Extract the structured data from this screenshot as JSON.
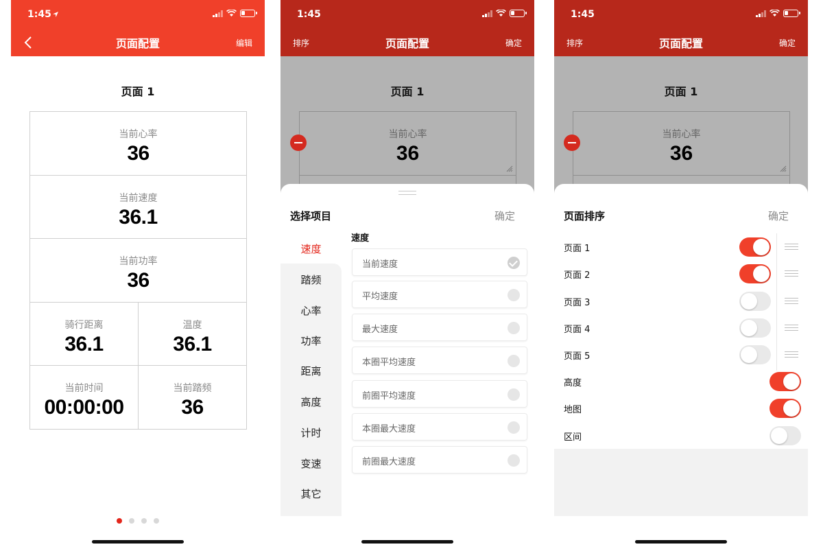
{
  "status": {
    "time": "1:45"
  },
  "screen1": {
    "title": "页面配置",
    "right_action": "编辑",
    "page_label": "页面 1",
    "cells": [
      {
        "label": "当前心率",
        "value": "36"
      },
      {
        "label": "当前速度",
        "value": "36.1"
      },
      {
        "label": "当前功率",
        "value": "36"
      },
      {
        "label": "骑行距离",
        "value": "36.1"
      },
      {
        "label": "温度",
        "value": "36.1"
      },
      {
        "label": "当前时间",
        "value": "00:00:00"
      },
      {
        "label": "当前踏频",
        "value": "36"
      }
    ],
    "page_dots": 4,
    "active_dot": 0
  },
  "screen2": {
    "left_action": "排序",
    "title": "页面配置",
    "right_action": "确定",
    "page_label": "页面 1",
    "preview_cell": {
      "label": "当前心率",
      "value": "36"
    },
    "sheet_title": "选择项目",
    "sheet_ok": "确定",
    "categories": [
      "速度",
      "踏频",
      "心率",
      "功率",
      "距离",
      "高度",
      "计时",
      "变速",
      "其它"
    ],
    "active_category": 0,
    "section_title": "速度",
    "items": [
      {
        "label": "当前速度",
        "checked": true
      },
      {
        "label": "平均速度",
        "checked": false
      },
      {
        "label": "最大速度",
        "checked": false
      },
      {
        "label": "本圈平均速度",
        "checked": false
      },
      {
        "label": "前圈平均速度",
        "checked": false
      },
      {
        "label": "本圈最大速度",
        "checked": false
      },
      {
        "label": "前圈最大速度",
        "checked": false
      }
    ]
  },
  "screen3": {
    "left_action": "排序",
    "title": "页面配置",
    "right_action": "确定",
    "page_label": "页面 1",
    "preview_cell": {
      "label": "当前心率",
      "value": "36"
    },
    "sheet_title": "页面排序",
    "sheet_ok": "确定",
    "pages": [
      {
        "label": "页面 1",
        "on": true
      },
      {
        "label": "页面 2",
        "on": true
      },
      {
        "label": "页面 3",
        "on": false
      },
      {
        "label": "页面 4",
        "on": false
      },
      {
        "label": "页面 5",
        "on": false
      }
    ],
    "extras": [
      {
        "label": "高度",
        "on": true
      },
      {
        "label": "地图",
        "on": true
      },
      {
        "label": "区间",
        "on": false
      }
    ]
  },
  "colors": {
    "header_active": "#f0402a",
    "header_dim": "#b7281b",
    "accent": "#e3261b"
  }
}
